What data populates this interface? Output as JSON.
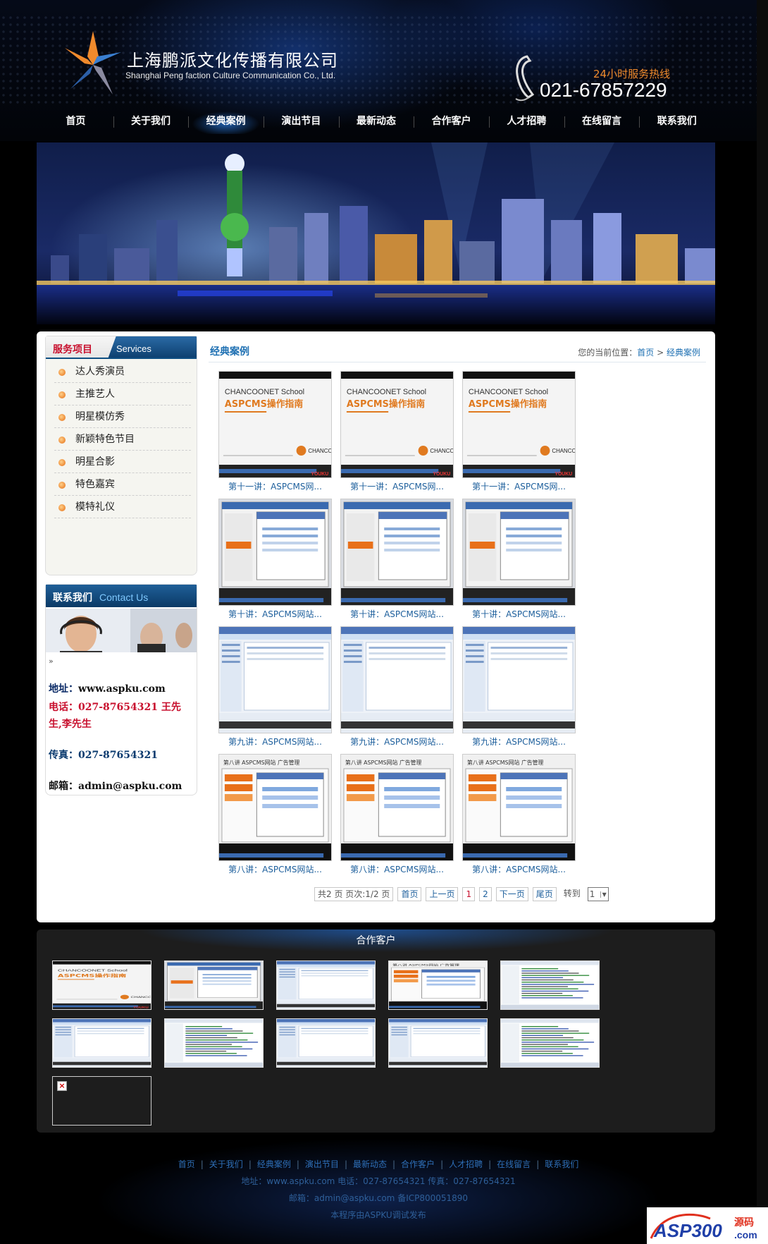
{
  "header": {
    "company_cn": "上海鹏派文化传播有限公司",
    "company_en": "Shanghai Peng faction Culture Communication Co., Ltd.",
    "hotline_label": "24小时服务热线",
    "hotline_number": "021-67857229"
  },
  "nav": {
    "items": [
      "首页",
      "关于我们",
      "经典案例",
      "演出节目",
      "最新动态",
      "合作客户",
      "人才招聘",
      "在线留言",
      "联系我们"
    ],
    "active": "经典案例"
  },
  "sidebar": {
    "services_title_cn": "服务项目",
    "services_title_en": "Services",
    "services": [
      "达人秀演员",
      "主推艺人",
      "明星模仿秀",
      "新颖特色节目",
      "明星合影",
      "特色嘉宾",
      "模特礼仪"
    ],
    "contact_title_cn": "联系我们",
    "contact_title_en": "Contact Us",
    "contact_arrow": "»",
    "address_label": "地址：",
    "address_value": "www.aspku.com",
    "tel_label": "电话：",
    "tel_value": "027-87654321 王先生,李先生",
    "fax_label": "传真：",
    "fax_value": "027-87654321",
    "email_label": "邮箱：",
    "email_value": "admin@aspku.com"
  },
  "content": {
    "title": "经典案例",
    "breadcrumb_prefix": "您的当前位置：",
    "breadcrumb_home": "首页",
    "breadcrumb_sep": " > ",
    "breadcrumb_current": "经典案例",
    "thumb_text": {
      "school": "CHANCOONET School",
      "guide": "ASPCMS操作指南",
      "lesson8_header": "第八讲 ASPCMS网站 广告管理",
      "brand": "CHANCOO",
      "video_badge": "YOUKU"
    },
    "cases": [
      {
        "title": "第十一讲：ASPCMS网...",
        "kind": "cover"
      },
      {
        "title": "第十一讲：ASPCMS网...",
        "kind": "cover"
      },
      {
        "title": "第十一讲：ASPCMS网...",
        "kind": "cover"
      },
      {
        "title": "第十讲：ASPCMS网站...",
        "kind": "dialog"
      },
      {
        "title": "第十讲：ASPCMS网站...",
        "kind": "dialog"
      },
      {
        "title": "第十讲：ASPCMS网站...",
        "kind": "dialog"
      },
      {
        "title": "第九讲：ASPCMS网站...",
        "kind": "admin"
      },
      {
        "title": "第九讲：ASPCMS网站...",
        "kind": "admin"
      },
      {
        "title": "第九讲：ASPCMS网站...",
        "kind": "admin"
      },
      {
        "title": "第八讲：ASPCMS网站...",
        "kind": "lesson8"
      },
      {
        "title": "第八讲：ASPCMS网站...",
        "kind": "lesson8"
      },
      {
        "title": "第八讲：ASPCMS网站...",
        "kind": "lesson8"
      }
    ],
    "pager": {
      "summary": "共2 页 页次:1/2 页",
      "first": "首页",
      "prev": "上一页",
      "pages": [
        "1",
        "2"
      ],
      "next": "下一页",
      "last": "尾页",
      "goto_label": "转到",
      "goto_value": "1"
    }
  },
  "partners": {
    "title": "合作客户",
    "broken_icon": "×",
    "items": [
      {
        "kind": "cover"
      },
      {
        "kind": "dialog"
      },
      {
        "kind": "admin"
      },
      {
        "kind": "lesson8"
      },
      {
        "kind": "code"
      },
      {
        "kind": "admin"
      },
      {
        "kind": "code"
      },
      {
        "kind": "admin"
      },
      {
        "kind": "admin"
      },
      {
        "kind": "code"
      },
      {
        "kind": "broken"
      }
    ]
  },
  "footer": {
    "links": [
      "首页",
      "关于我们",
      "经典案例",
      "演出节目",
      "最新动态",
      "合作客户",
      "人才招聘",
      "在线留言",
      "联系我们"
    ],
    "separator": "|",
    "line1": "地址：www.aspku.com 电话：027-87654321 传真：027-87654321",
    "line2": "邮箱：admin@aspku.com 备ICP800051890",
    "line3": "本程序由ASPKU调试发布"
  },
  "watermark": {
    "text_main": "ASP300",
    "text_cn": "源码",
    "text_com": ".com"
  }
}
